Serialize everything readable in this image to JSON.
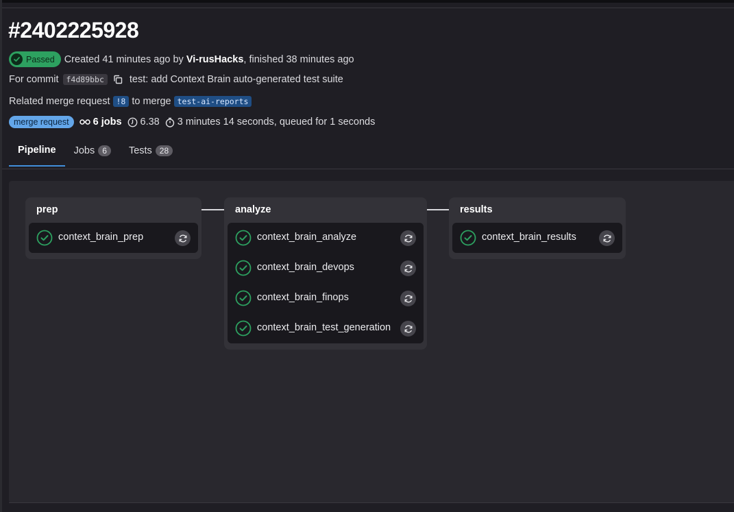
{
  "pipeline": {
    "id": "#2402225928",
    "status": "Passed",
    "created_prefix": "Created 41 minutes ago by",
    "author": "Vi-rusHacks",
    "finished": ", finished 38 minutes ago",
    "commit_label": "For commit",
    "commit_sha": "f4d89bbc",
    "commit_message": "test: add Context Brain auto-generated test suite",
    "mr_label": "Related merge request",
    "mr_ref": "!8",
    "mr_to": "to merge",
    "mr_branch": "test-ai-reports",
    "source_badge": "merge request",
    "jobs_count": "6 jobs",
    "compute": "6.38",
    "duration": "3 minutes 14 seconds, queued for 1 seconds"
  },
  "tabs": [
    {
      "label": "Pipeline"
    },
    {
      "label": "Jobs",
      "count": "6"
    },
    {
      "label": "Tests",
      "count": "28"
    }
  ],
  "stages": [
    {
      "name": "prep",
      "jobs": [
        "context_brain_prep"
      ]
    },
    {
      "name": "analyze",
      "jobs": [
        "context_brain_analyze",
        "context_brain_devops",
        "context_brain_finops",
        "context_brain_test_generation"
      ]
    },
    {
      "name": "results",
      "jobs": [
        "context_brain_results"
      ]
    }
  ],
  "icons": {
    "status": "check-circle-icon",
    "retry": "retry-icon",
    "copy": "copy-icon",
    "jobs": "pipeline-icon",
    "compute": "compute-icon",
    "timer": "clock-icon"
  },
  "colors": {
    "success": "#2da160",
    "accent": "#428fdc",
    "mr_badge": "#63a6e9"
  }
}
